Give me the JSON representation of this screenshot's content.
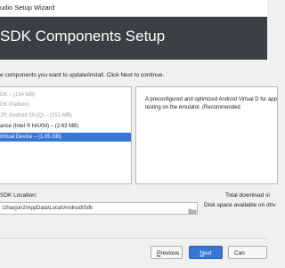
{
  "window": {
    "title": "udio Setup Wizard"
  },
  "header": {
    "title": "SDK Components Setup",
    "background": "#3c3f41"
  },
  "instruction": "e components you want to update/install. Click Next to continue.",
  "components": [
    {
      "label": "l SDK – (194 MB)",
      "state": "disabled"
    },
    {
      "label": "l SDK Platform",
      "state": "disabled"
    },
    {
      "label": "PI 29: Android 10 (Q) – (151 MB)",
      "state": "disabled"
    },
    {
      "label": "rmance (Intel ® HAXM) – (2.63 MB)",
      "state": "normal"
    },
    {
      "label": "id Virtual Device – (1.05 GB)",
      "state": "selected"
    }
  ],
  "description": {
    "text": "A preconfigured and optimized Android Virtual D for app testing on the emulator. (Recommended"
  },
  "sdk_location": {
    "label": "SDK Location:",
    "path": ":\\zhaojun2\\AppData\\Local\\Android\\Sdk",
    "folder_icon": "folder-icon"
  },
  "download_info": {
    "total_download": "Total download si",
    "disk_space": "Disk space available on driv"
  },
  "buttons": {
    "previous": {
      "mnemonic": "P",
      "rest": "revious"
    },
    "next": {
      "mnemonic": "N",
      "rest": "ext"
    },
    "cancel": {
      "label": "Can"
    }
  },
  "colors": {
    "accent": "#3875d7",
    "disabled_text": "#a0a0a0"
  }
}
